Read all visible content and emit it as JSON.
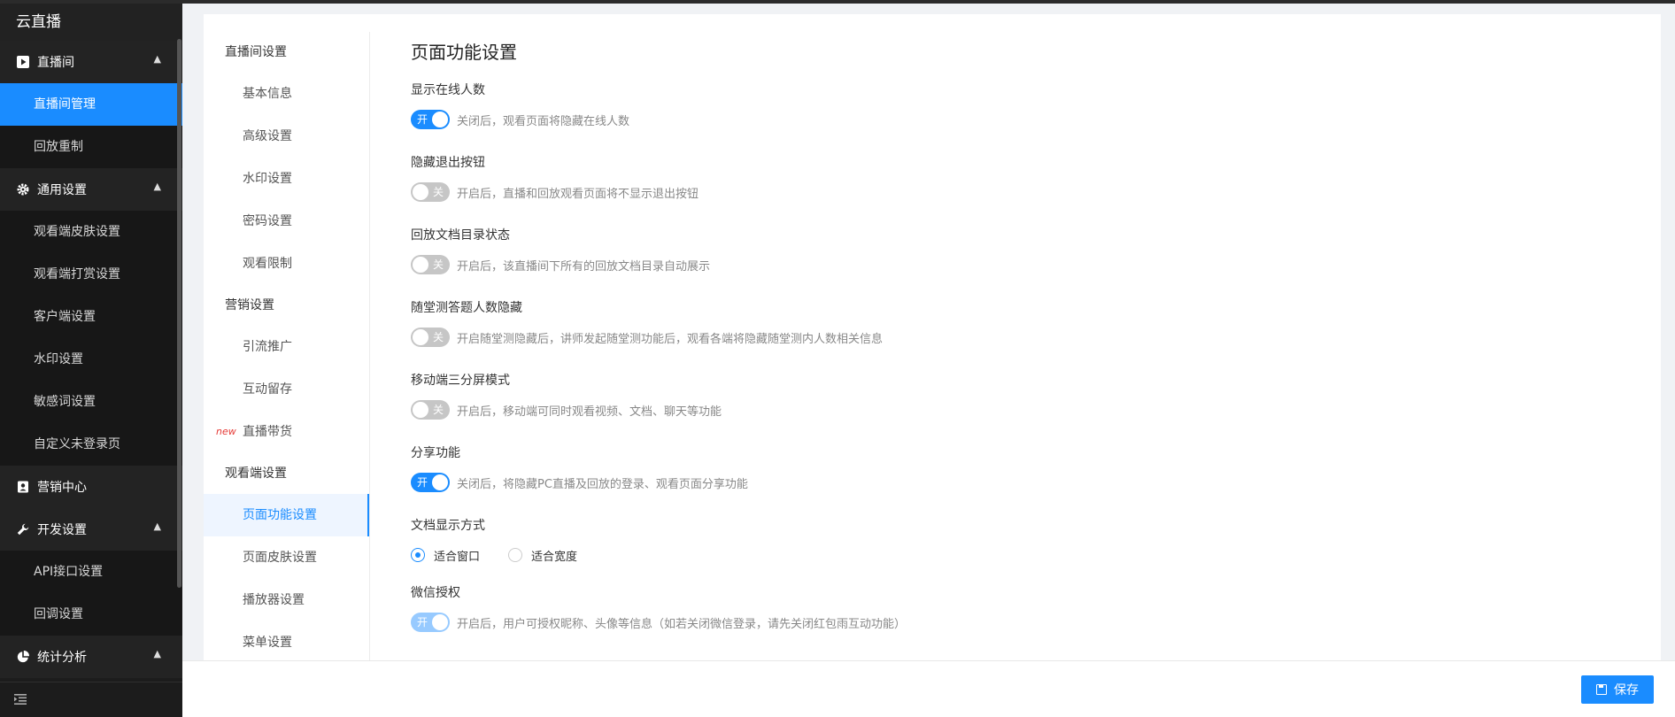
{
  "sidebar": {
    "brand": "云直播",
    "groups": [
      {
        "label": "直播间",
        "icon": "play-icon",
        "expanded": true,
        "items": [
          {
            "label": "直播间管理",
            "active": true
          },
          {
            "label": "回放重制"
          }
        ]
      },
      {
        "label": "通用设置",
        "icon": "gear-icon",
        "expanded": true,
        "items": [
          {
            "label": "观看端皮肤设置"
          },
          {
            "label": "观看端打赏设置"
          },
          {
            "label": "客户端设置"
          },
          {
            "label": "水印设置"
          },
          {
            "label": "敏感词设置"
          },
          {
            "label": "自定义未登录页"
          }
        ]
      },
      {
        "label": "营销中心",
        "icon": "marketing-icon",
        "expanded": false,
        "items": []
      },
      {
        "label": "开发设置",
        "icon": "wrench-icon",
        "expanded": true,
        "items": [
          {
            "label": "API接口设置"
          },
          {
            "label": "回调设置"
          }
        ]
      },
      {
        "label": "统计分析",
        "icon": "pie-chart-icon",
        "expanded": true,
        "items": []
      }
    ]
  },
  "subnav": {
    "sections": [
      {
        "label": "直播间设置",
        "items": [
          {
            "label": "基本信息"
          },
          {
            "label": "高级设置"
          },
          {
            "label": "水印设置"
          },
          {
            "label": "密码设置"
          },
          {
            "label": "观看限制"
          }
        ]
      },
      {
        "label": "营销设置",
        "items": [
          {
            "label": "引流推广"
          },
          {
            "label": "互动留存"
          },
          {
            "label": "直播带货",
            "tag": "new"
          }
        ]
      },
      {
        "label": "观看端设置",
        "items": [
          {
            "label": "页面功能设置",
            "active": true
          },
          {
            "label": "页面皮肤设置"
          },
          {
            "label": "播放器设置"
          },
          {
            "label": "菜单设置"
          }
        ]
      }
    ]
  },
  "page": {
    "title": "页面功能设置",
    "settings": [
      {
        "label": "显示在线人数",
        "state": "on",
        "toggle_text": "开",
        "desc": "关闭后，观看页面将隐藏在线人数"
      },
      {
        "label": "隐藏退出按钮",
        "state": "off",
        "toggle_text": "关",
        "desc": "开启后，直播和回放观看页面将不显示退出按钮"
      },
      {
        "label": "回放文档目录状态",
        "state": "off",
        "toggle_text": "关",
        "desc": "开启后，该直播间下所有的回放文档目录自动展示"
      },
      {
        "label": "随堂测答题人数隐藏",
        "state": "off",
        "toggle_text": "关",
        "desc": "开启随堂测隐藏后，讲师发起随堂测功能后，观看各端将隐藏随堂测内人数相关信息"
      },
      {
        "label": "移动端三分屏模式",
        "state": "off",
        "toggle_text": "关",
        "desc": "开启后，移动端可同时观看视频、文档、聊天等功能"
      },
      {
        "label": "分享功能",
        "state": "on",
        "toggle_text": "开",
        "desc": "关闭后，将隐藏PC直播及回放的登录、观看页面分享功能"
      }
    ],
    "doc_display": {
      "label": "文档显示方式",
      "options": [
        {
          "label": "适合窗口",
          "checked": true
        },
        {
          "label": "适合宽度",
          "checked": false
        }
      ]
    },
    "wechat": {
      "label": "微信授权",
      "state": "on-disabled",
      "toggle_text": "开",
      "desc": "开启后，用户可授权昵称、头像等信息（如若关闭微信登录，请先关闭红包雨互动功能）"
    }
  },
  "footer": {
    "save_label": "保存"
  },
  "colors": {
    "accent": "#1a8cff",
    "sidebar_bg": "#1c1c1c",
    "new_tag": "#e53935"
  }
}
